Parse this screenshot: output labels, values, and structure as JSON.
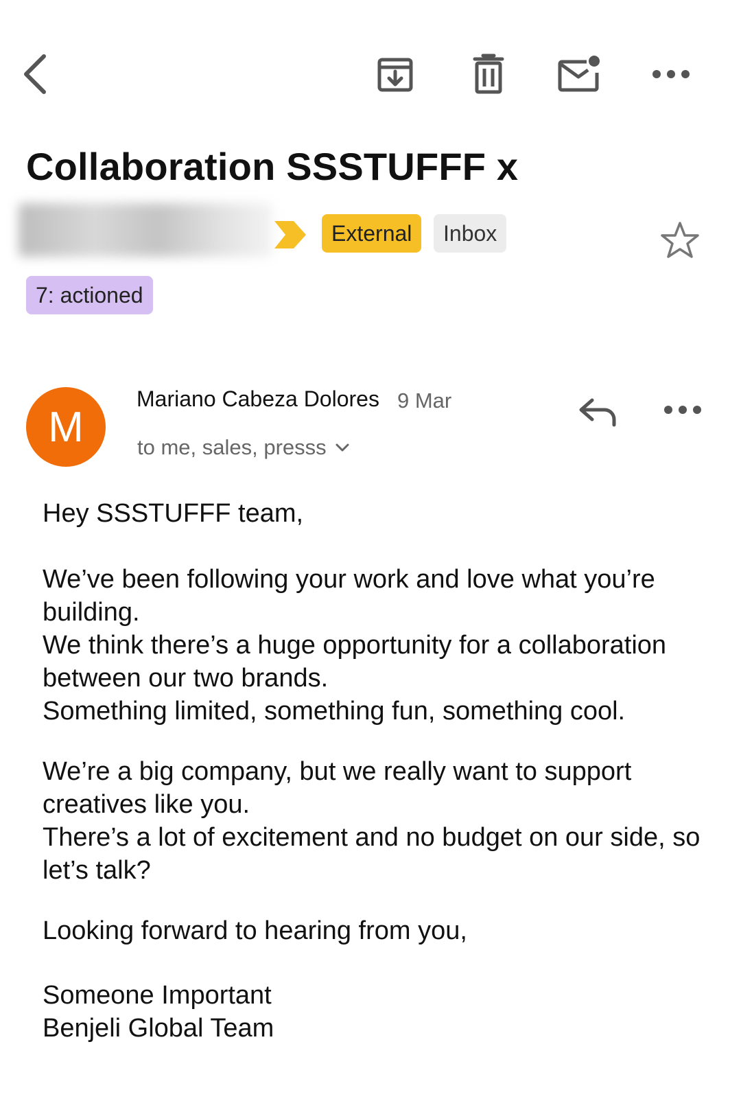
{
  "toolbar": {
    "icons": [
      "back-arrow-icon",
      "archive-icon",
      "trash-icon",
      "mark-unread-icon",
      "more-horiz-icon"
    ]
  },
  "subject": "Collaboration SSSTUFFF x",
  "labels": {
    "external": "External",
    "inbox": "Inbox",
    "actioned": "7: actioned"
  },
  "colors": {
    "external_chip": "#f6bf26",
    "inbox_chip": "#ececec",
    "actioned_chip": "#d6bff2",
    "avatar": "#f16d0a",
    "importance_marker": "#f6bf26"
  },
  "message": {
    "avatar_letter": "M",
    "sender": "Mariano Cabeza Dolores",
    "date": "9 Mar",
    "recipients": "to me, sales, presss"
  },
  "body": {
    "greeting": "Hey SSSTUFFF team,",
    "p1_l1": "We’ve been following your work and love what you’re building.",
    "p1_l2": "We think there’s a huge opportunity for a collaboration between our two brands.",
    "p1_l3": "Something limited, something fun, something cool.",
    "p2_l1": "We’re a big company, but we really want to support creatives like you.",
    "p2_l2": "There’s a lot of excitement and no budget on our side, so let’s talk?",
    "closing": "Looking forward to hearing from you,",
    "sig_name": "Someone Important",
    "sig_team": "Benjeli Global Team"
  }
}
